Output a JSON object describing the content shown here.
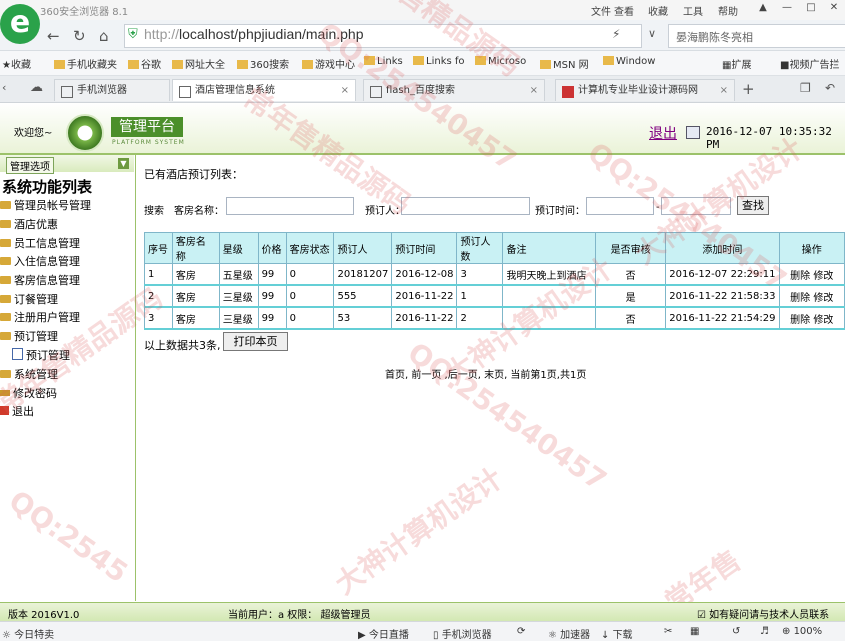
{
  "browser": {
    "app_title": "360安全浏览器 8.1",
    "menu": [
      "文件",
      "查看",
      "收藏",
      "工具",
      "帮助"
    ],
    "url_proto": "http://",
    "url_rest": "localhost/phpjiudian/main.php",
    "search_hint": "晏海鹏陈冬亮相",
    "bookmarks": [
      "收藏",
      "手机收藏夹",
      "谷歌",
      "网址大全",
      "360搜索",
      "游戏中心",
      "Links",
      "Links fo",
      "Microso",
      "MSN 网",
      "Window"
    ],
    "bm_right": [
      "扩展",
      "视频广告拦"
    ],
    "tabs": [
      {
        "label": "手机浏览器"
      },
      {
        "label": "酒店管理信息系统"
      },
      {
        "label": "flash_百度搜索"
      },
      {
        "label": "计算机专业毕业设计源码网"
      }
    ],
    "status": {
      "left": "今日特卖",
      "live": "今日直播",
      "mobile": "手机浏览器",
      "accel": "加速器",
      "download": "下载",
      "zoom": "100%"
    }
  },
  "header": {
    "welcome": "欢迎您~",
    "logo_text": "管理平台",
    "logo_sub": "PLATFORM SYSTEM",
    "logout": "退出",
    "datetime": "2016-12-07 10:35:32 PM"
  },
  "sidebar": {
    "opt_label": "管理选项",
    "title": "系统功能列表",
    "items": [
      "管理员帐号管理",
      "酒店优惠",
      "员工信息管理",
      "入住信息管理",
      "客房信息管理",
      "订餐管理",
      "注册用户管理",
      "预订管理"
    ],
    "sub_item": "预订管理",
    "items_after": [
      "系统管理"
    ],
    "password": "修改密码",
    "exit": "退出"
  },
  "main": {
    "list_title": "已有酒店预订列表：",
    "search": {
      "label": "搜索",
      "room_label": "客房名称：",
      "person_label": "预订人：",
      "time_label": "预订时间：",
      "dash": "-",
      "button": "查找"
    },
    "columns": [
      "序号",
      "客房名称",
      "星级",
      "价格",
      "客房状态",
      "预订人",
      "预订时间",
      "预订人数",
      "备注",
      "是否审核",
      "添加时间",
      "操作"
    ],
    "rows": [
      [
        "1",
        "客房",
        "五星级",
        "99",
        "0",
        "20181207",
        "2016-12-08",
        "3",
        "我明天晚上到酒店",
        "否",
        "2016-12-07 22:29:11",
        "删除 修改"
      ],
      [
        "2",
        "客房",
        "三星级",
        "99",
        "0",
        "555",
        "2016-11-22",
        "1",
        "",
        "是",
        "2016-11-22 21:58:33",
        "删除 修改"
      ],
      [
        "3",
        "客房",
        "三星级",
        "99",
        "0",
        "53",
        "2016-11-22",
        "2",
        "",
        "否",
        "2016-11-22 21:54:29",
        "删除 修改"
      ]
    ],
    "summary": "以上数据共3条,",
    "print_btn": "打印本页",
    "pager": "首页, 前一页 ,后一页, 末页, 当前第1页,共1页"
  },
  "footer": {
    "version": "版本 2016V1.0",
    "current_user": "当前用户：a 权限： 超级管理员",
    "help": "如有疑问请与技术人员联系"
  },
  "watermarks": [
    "售精品源码",
    "QQ:254540457",
    "大神计算机设计",
    "常年售精品源码",
    "QQ:254540457",
    "大神计算机设计",
    "常年售精品源码",
    "QQ:254540457",
    "大神计算机设计",
    "QQ:2545",
    "常年售"
  ]
}
